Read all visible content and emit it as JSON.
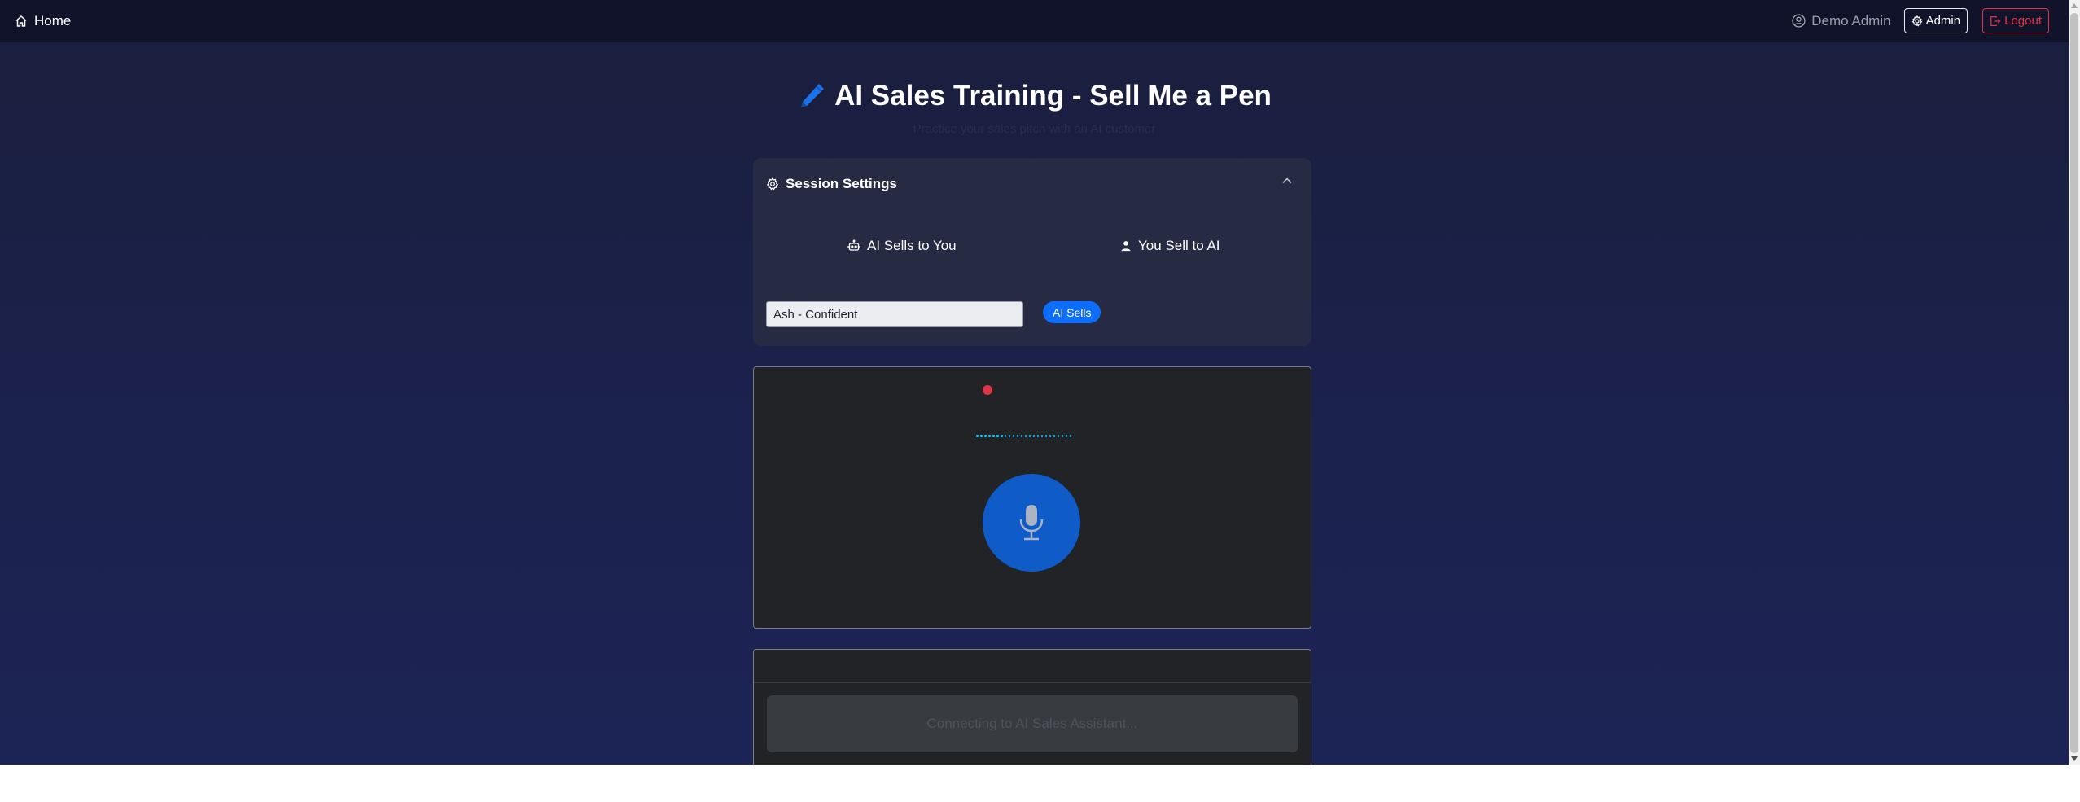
{
  "nav": {
    "home_label": "Home",
    "user_name": "Demo Admin",
    "admin_label": "Admin",
    "logout_label": "Logout"
  },
  "header": {
    "title": "AI Sales Training - Sell Me a Pen",
    "subtitle": "Practice your sales pitch with an AI customer"
  },
  "settings": {
    "title": "Session Settings",
    "modes": [
      {
        "label": "AI Sells to You",
        "icon": "robot-icon"
      },
      {
        "label": "You Sell to AI",
        "icon": "person-icon"
      }
    ],
    "persona_selected": "Ash - Confident",
    "mode_badge": "AI Sells"
  },
  "voice": {
    "recording_color": "#dc3545",
    "mic_icon": "microphone-icon"
  },
  "chat": {
    "status_text": "Connecting to AI Sales Assistant..."
  },
  "colors": {
    "accent": "#0d6efd",
    "danger": "#dc3545",
    "wave": "#0dcaf0"
  }
}
